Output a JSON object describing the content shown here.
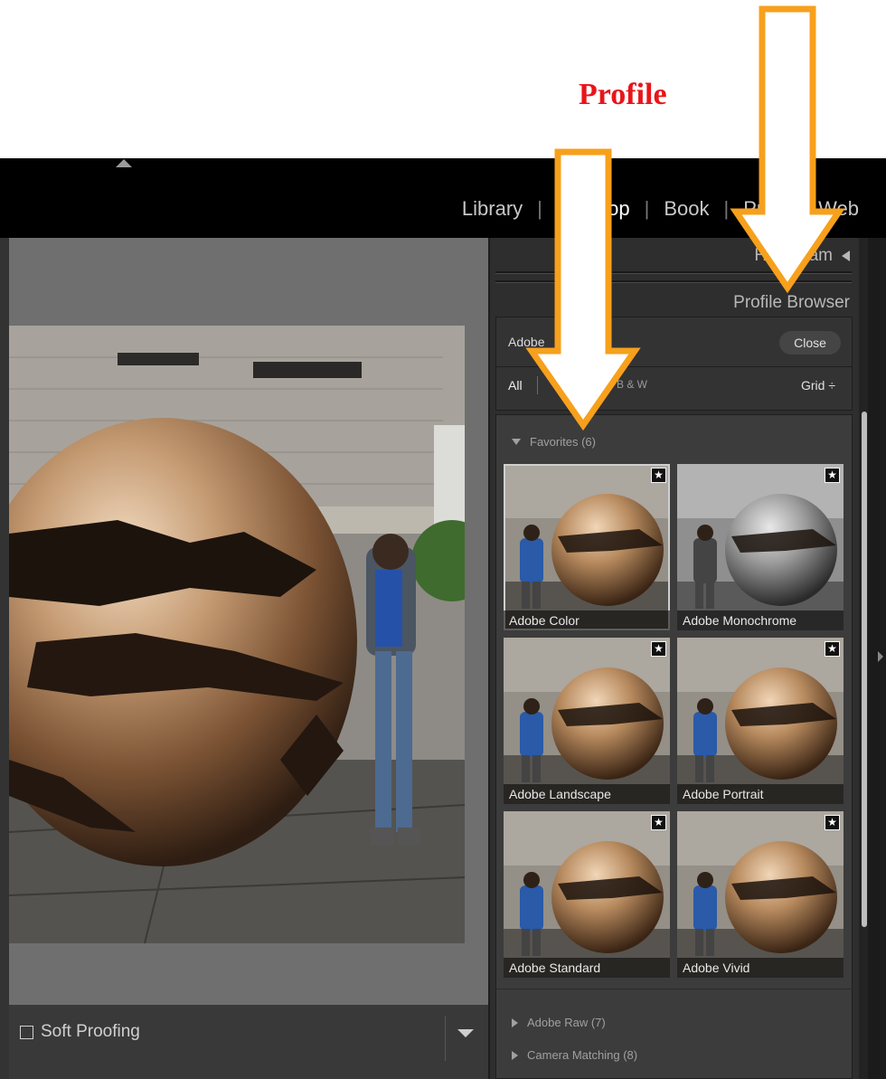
{
  "annotation": {
    "label": "Profile"
  },
  "modules": {
    "items": [
      "Library",
      "Develop",
      "Book",
      "Print",
      "Web"
    ],
    "active": "Develop"
  },
  "panels": {
    "histogram": "Histogram",
    "profile_browser": "Profile Browser"
  },
  "profile_browser": {
    "group_select": "Adobe",
    "close_label": "Close",
    "filter_all": "All",
    "filter_bw": "B & W",
    "view_select": "Grid ÷"
  },
  "favorites": {
    "header": "Favorites (6)",
    "items": [
      {
        "label": "Adobe Color",
        "tone": "color",
        "selected": true
      },
      {
        "label": "Adobe Monochrome",
        "tone": "mono",
        "selected": false
      },
      {
        "label": "Adobe Landscape",
        "tone": "color",
        "selected": false
      },
      {
        "label": "Adobe Portrait",
        "tone": "color",
        "selected": false
      },
      {
        "label": "Adobe Standard",
        "tone": "color",
        "selected": false
      },
      {
        "label": "Adobe Vivid",
        "tone": "color",
        "selected": false
      }
    ]
  },
  "groups": [
    {
      "label": "Adobe Raw (7)"
    },
    {
      "label": "Camera Matching (8)"
    }
  ],
  "bottom": {
    "soft_proofing": "Soft Proofing"
  },
  "colors": {
    "arrow": "#f7a01c",
    "annotation": "#e8151b",
    "panel": "#2e2e2e"
  }
}
